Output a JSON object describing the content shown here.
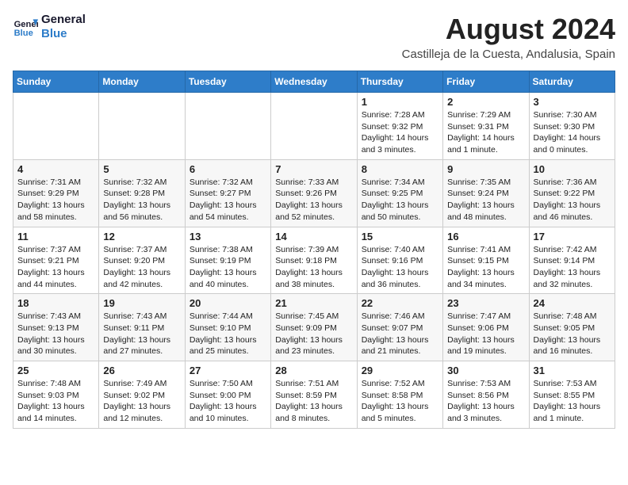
{
  "logo": {
    "line1": "General",
    "line2": "Blue"
  },
  "title": "August 2024",
  "location": "Castilleja de la Cuesta, Andalusia, Spain",
  "days_of_week": [
    "Sunday",
    "Monday",
    "Tuesday",
    "Wednesday",
    "Thursday",
    "Friday",
    "Saturday"
  ],
  "weeks": [
    [
      {
        "day": "",
        "info": ""
      },
      {
        "day": "",
        "info": ""
      },
      {
        "day": "",
        "info": ""
      },
      {
        "day": "",
        "info": ""
      },
      {
        "day": "1",
        "info": "Sunrise: 7:28 AM\nSunset: 9:32 PM\nDaylight: 14 hours\nand 3 minutes."
      },
      {
        "day": "2",
        "info": "Sunrise: 7:29 AM\nSunset: 9:31 PM\nDaylight: 14 hours\nand 1 minute."
      },
      {
        "day": "3",
        "info": "Sunrise: 7:30 AM\nSunset: 9:30 PM\nDaylight: 14 hours\nand 0 minutes."
      }
    ],
    [
      {
        "day": "4",
        "info": "Sunrise: 7:31 AM\nSunset: 9:29 PM\nDaylight: 13 hours\nand 58 minutes."
      },
      {
        "day": "5",
        "info": "Sunrise: 7:32 AM\nSunset: 9:28 PM\nDaylight: 13 hours\nand 56 minutes."
      },
      {
        "day": "6",
        "info": "Sunrise: 7:32 AM\nSunset: 9:27 PM\nDaylight: 13 hours\nand 54 minutes."
      },
      {
        "day": "7",
        "info": "Sunrise: 7:33 AM\nSunset: 9:26 PM\nDaylight: 13 hours\nand 52 minutes."
      },
      {
        "day": "8",
        "info": "Sunrise: 7:34 AM\nSunset: 9:25 PM\nDaylight: 13 hours\nand 50 minutes."
      },
      {
        "day": "9",
        "info": "Sunrise: 7:35 AM\nSunset: 9:24 PM\nDaylight: 13 hours\nand 48 minutes."
      },
      {
        "day": "10",
        "info": "Sunrise: 7:36 AM\nSunset: 9:22 PM\nDaylight: 13 hours\nand 46 minutes."
      }
    ],
    [
      {
        "day": "11",
        "info": "Sunrise: 7:37 AM\nSunset: 9:21 PM\nDaylight: 13 hours\nand 44 minutes."
      },
      {
        "day": "12",
        "info": "Sunrise: 7:37 AM\nSunset: 9:20 PM\nDaylight: 13 hours\nand 42 minutes."
      },
      {
        "day": "13",
        "info": "Sunrise: 7:38 AM\nSunset: 9:19 PM\nDaylight: 13 hours\nand 40 minutes."
      },
      {
        "day": "14",
        "info": "Sunrise: 7:39 AM\nSunset: 9:18 PM\nDaylight: 13 hours\nand 38 minutes."
      },
      {
        "day": "15",
        "info": "Sunrise: 7:40 AM\nSunset: 9:16 PM\nDaylight: 13 hours\nand 36 minutes."
      },
      {
        "day": "16",
        "info": "Sunrise: 7:41 AM\nSunset: 9:15 PM\nDaylight: 13 hours\nand 34 minutes."
      },
      {
        "day": "17",
        "info": "Sunrise: 7:42 AM\nSunset: 9:14 PM\nDaylight: 13 hours\nand 32 minutes."
      }
    ],
    [
      {
        "day": "18",
        "info": "Sunrise: 7:43 AM\nSunset: 9:13 PM\nDaylight: 13 hours\nand 30 minutes."
      },
      {
        "day": "19",
        "info": "Sunrise: 7:43 AM\nSunset: 9:11 PM\nDaylight: 13 hours\nand 27 minutes."
      },
      {
        "day": "20",
        "info": "Sunrise: 7:44 AM\nSunset: 9:10 PM\nDaylight: 13 hours\nand 25 minutes."
      },
      {
        "day": "21",
        "info": "Sunrise: 7:45 AM\nSunset: 9:09 PM\nDaylight: 13 hours\nand 23 minutes."
      },
      {
        "day": "22",
        "info": "Sunrise: 7:46 AM\nSunset: 9:07 PM\nDaylight: 13 hours\nand 21 minutes."
      },
      {
        "day": "23",
        "info": "Sunrise: 7:47 AM\nSunset: 9:06 PM\nDaylight: 13 hours\nand 19 minutes."
      },
      {
        "day": "24",
        "info": "Sunrise: 7:48 AM\nSunset: 9:05 PM\nDaylight: 13 hours\nand 16 minutes."
      }
    ],
    [
      {
        "day": "25",
        "info": "Sunrise: 7:48 AM\nSunset: 9:03 PM\nDaylight: 13 hours\nand 14 minutes."
      },
      {
        "day": "26",
        "info": "Sunrise: 7:49 AM\nSunset: 9:02 PM\nDaylight: 13 hours\nand 12 minutes."
      },
      {
        "day": "27",
        "info": "Sunrise: 7:50 AM\nSunset: 9:00 PM\nDaylight: 13 hours\nand 10 minutes."
      },
      {
        "day": "28",
        "info": "Sunrise: 7:51 AM\nSunset: 8:59 PM\nDaylight: 13 hours\nand 8 minutes."
      },
      {
        "day": "29",
        "info": "Sunrise: 7:52 AM\nSunset: 8:58 PM\nDaylight: 13 hours\nand 5 minutes."
      },
      {
        "day": "30",
        "info": "Sunrise: 7:53 AM\nSunset: 8:56 PM\nDaylight: 13 hours\nand 3 minutes."
      },
      {
        "day": "31",
        "info": "Sunrise: 7:53 AM\nSunset: 8:55 PM\nDaylight: 13 hours\nand 1 minute."
      }
    ]
  ]
}
